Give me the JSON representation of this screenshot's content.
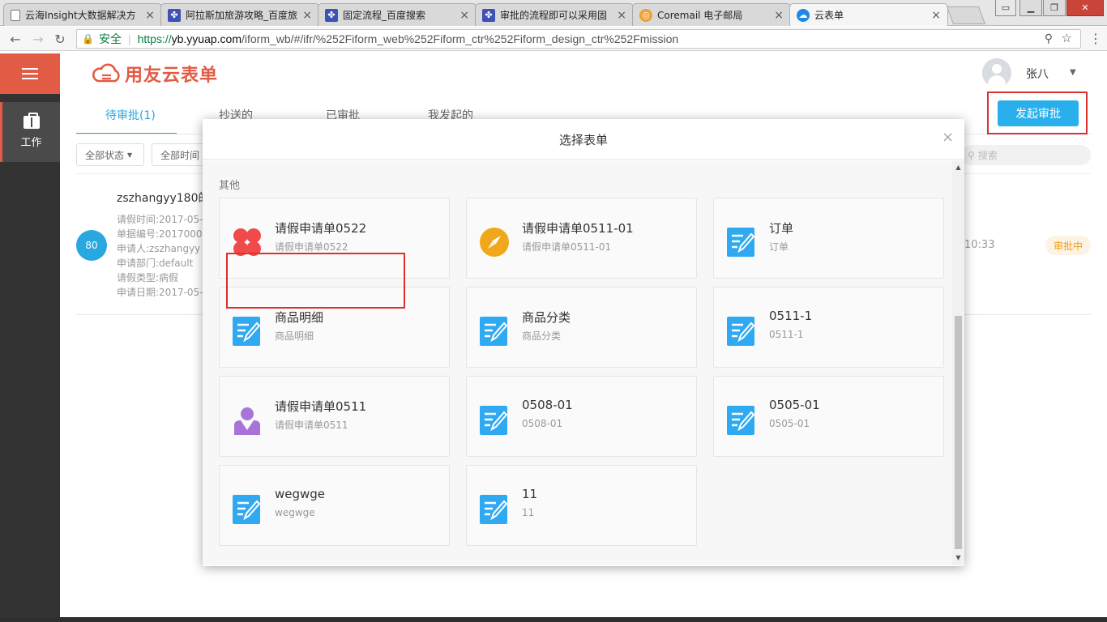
{
  "browser": {
    "tabs": [
      {
        "title": "云海Insight大数据解决方",
        "icon": "document-icon"
      },
      {
        "title": "阿拉斯加旅游攻略_百度旅",
        "icon": "baidu-paw-icon"
      },
      {
        "title": "固定流程_百度搜索",
        "icon": "baidu-paw-icon"
      },
      {
        "title": "审批的流程即可以采用固",
        "icon": "baidu-paw-icon"
      },
      {
        "title": "Coremail 电子邮局",
        "icon": "coremail-icon"
      },
      {
        "title": "云表单",
        "icon": "cloud-icon"
      }
    ],
    "security_label": "安全",
    "url_scheme": "https://",
    "url_host": "yb.yyuap.com",
    "url_path": "/iform_wb/#/ifr/%252Fiform_web%252Fiform_ctr%252Fiform_design_ctr%252Fmission"
  },
  "sidebar": {
    "work_label": "工作"
  },
  "header": {
    "logo_text": "用友云表单",
    "user_name": "张八"
  },
  "tabs": {
    "pending": "待审批(1)",
    "cc": "抄送的",
    "approved": "已审批",
    "initiated": "我发起的"
  },
  "start_button": "发起审批",
  "filters": {
    "status": "全部状态",
    "time": "全部时间",
    "search_placeholder": "搜索"
  },
  "list_item": {
    "avatar_text": "80",
    "title": "zszhangyy180的",
    "details": [
      "请假时间:2017-05-",
      "单据编号:2017000",
      "申请人:zszhangyy",
      "申请部门:default",
      "请假类型:病假",
      "申请日期:2017-05-"
    ],
    "time": "10:33",
    "status": "审批中"
  },
  "modal": {
    "title": "选择表单",
    "section": "其他",
    "cards": [
      {
        "name": "请假申请单0522",
        "sub": "请假申请单0522",
        "icon": "red-clover-icon"
      },
      {
        "name": "请假申请单0511-01",
        "sub": "请假申请单0511-01",
        "icon": "compass-icon"
      },
      {
        "name": "订单",
        "sub": "订单",
        "icon": "form-edit-icon"
      },
      {
        "name": "商品明细",
        "sub": "商品明细",
        "icon": "form-edit-icon"
      },
      {
        "name": "商品分类",
        "sub": "商品分类",
        "icon": "form-edit-icon"
      },
      {
        "name": "0511-1",
        "sub": "0511-1",
        "icon": "form-edit-icon"
      },
      {
        "name": "请假申请单0511",
        "sub": "请假申请单0511",
        "icon": "person-icon"
      },
      {
        "name": "0508-01",
        "sub": "0508-01",
        "icon": "form-edit-icon"
      },
      {
        "name": "0505-01",
        "sub": "0505-01",
        "icon": "form-edit-icon"
      },
      {
        "name": "wegwge",
        "sub": "wegwge",
        "icon": "form-edit-icon"
      },
      {
        "name": "11",
        "sub": "11",
        "icon": "form-edit-icon"
      }
    ]
  },
  "colors": {
    "brand": "#e25b45",
    "accent": "#29a7e1",
    "button": "#29b0ec",
    "highlight": "#d93030"
  }
}
